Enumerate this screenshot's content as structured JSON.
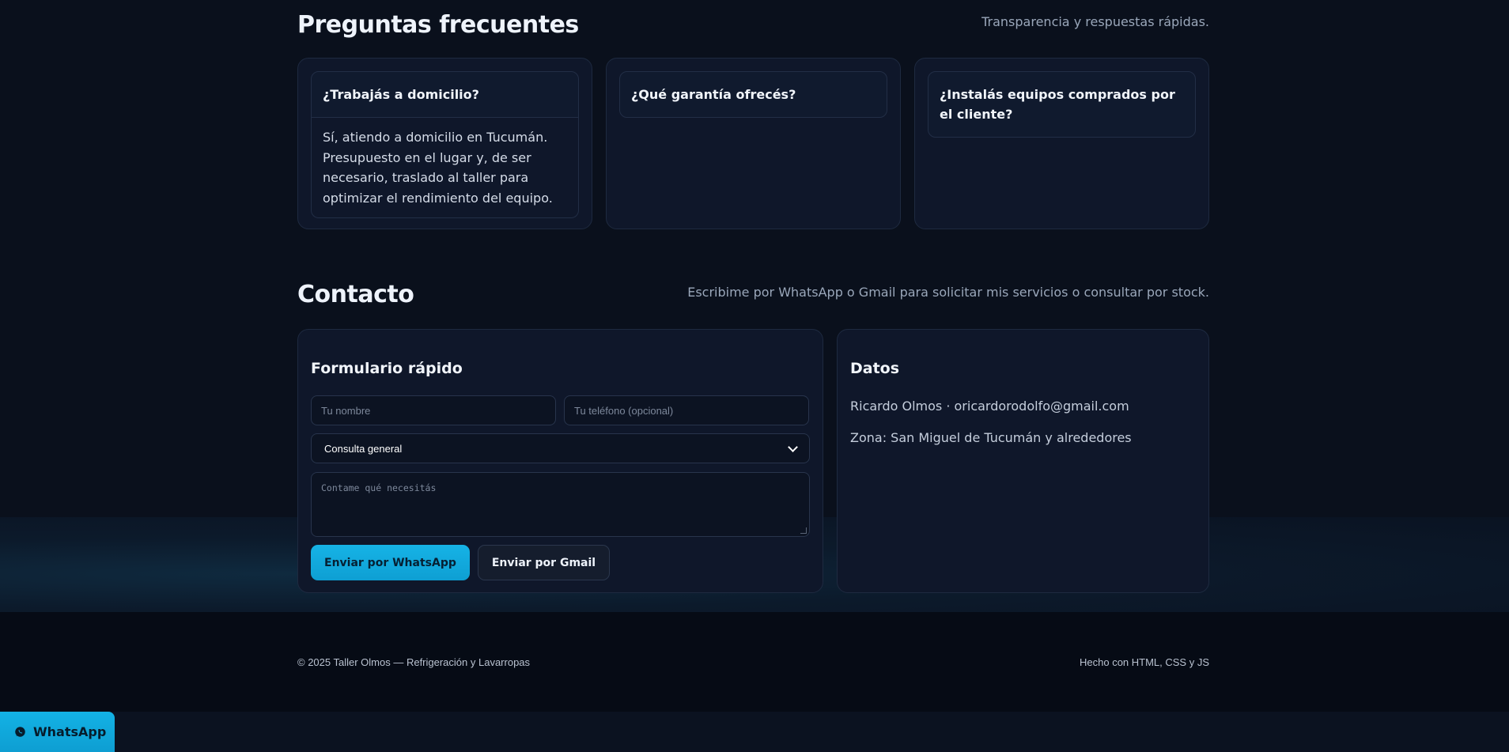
{
  "faq": {
    "title": "Preguntas frecuentes",
    "subtitle": "Transparencia y respuestas rápidas.",
    "items": [
      {
        "question": "¿Trabajás a domicilio?",
        "answer": "Sí, atiendo a domicilio en Tucumán. Presupuesto en el lugar y, de ser necesario, traslado al taller para optimizar el rendimiento del equipo.",
        "expanded": true
      },
      {
        "question": "¿Qué garantía ofrecés?",
        "answer": "",
        "expanded": false
      },
      {
        "question": "¿Instalás equipos comprados por el cliente?",
        "answer": "",
        "expanded": false
      }
    ]
  },
  "contact": {
    "title": "Contacto",
    "subtitle": "Escribime por WhatsApp o Gmail para solicitar mis servicios o consultar por stock.",
    "form": {
      "title": "Formulario rápido",
      "name_placeholder": "Tu nombre",
      "phone_placeholder": "Tu teléfono (opcional)",
      "select_value": "Consulta general",
      "message_placeholder": "Contame qué necesitás",
      "whatsapp_button": "Enviar por WhatsApp",
      "gmail_button": "Enviar por Gmail"
    },
    "data": {
      "title": "Datos",
      "line1": "Ricardo Olmos · oricardorodolfo@gmail.com",
      "line2": "Zona: San Miguel de Tucumán y alrededores"
    }
  },
  "footer": {
    "copyright": "© 2025 Taller Olmos — Refrigeración y Lavarropas",
    "made_with": "Hecho con HTML, CSS y JS"
  },
  "whatsapp_float": {
    "label": "WhatsApp",
    "icon": "whatsapp-icon"
  },
  "colors": {
    "accent": "#0ea5e9",
    "background": "#0a101c",
    "card": "#0f172a"
  }
}
